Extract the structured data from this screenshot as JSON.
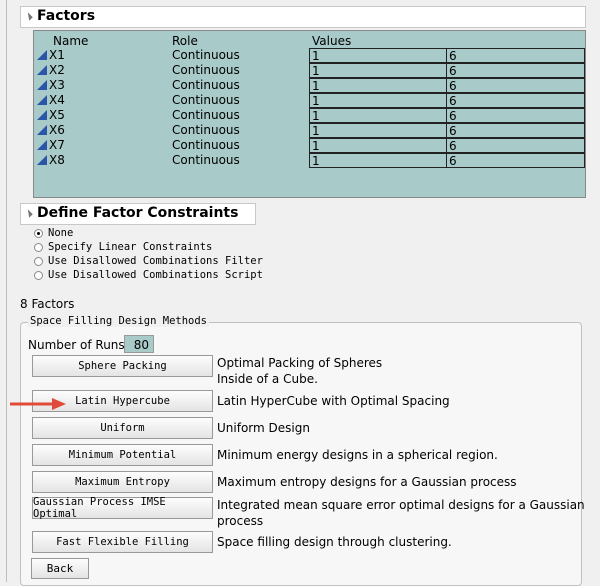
{
  "factors": {
    "title": "Factors",
    "columns": [
      "Name",
      "Role",
      "Values"
    ],
    "rows": [
      {
        "name": "X1",
        "role": "Continuous",
        "low": "1",
        "high": "6"
      },
      {
        "name": "X2",
        "role": "Continuous",
        "low": "1",
        "high": "6"
      },
      {
        "name": "X3",
        "role": "Continuous",
        "low": "1",
        "high": "6"
      },
      {
        "name": "X4",
        "role": "Continuous",
        "low": "1",
        "high": "6"
      },
      {
        "name": "X5",
        "role": "Continuous",
        "low": "1",
        "high": "6"
      },
      {
        "name": "X6",
        "role": "Continuous",
        "low": "1",
        "high": "6"
      },
      {
        "name": "X7",
        "role": "Continuous",
        "low": "1",
        "high": "6"
      },
      {
        "name": "X8",
        "role": "Continuous",
        "low": "1",
        "high": "6"
      }
    ]
  },
  "constraints": {
    "title": "Define Factor Constraints",
    "options": [
      "None",
      "Specify Linear Constraints",
      "Use Disallowed Combinations Filter",
      "Use Disallowed Combinations Script"
    ],
    "selected": "None"
  },
  "factor_count": "8 Factors",
  "methods": {
    "title": "Space Filling Design Methods",
    "runs_label": "Number of Runs:",
    "runs_value": "80",
    "buttons": [
      {
        "label": "Sphere Packing",
        "desc": "Optimal Packing of Spheres\nInside of a Cube."
      },
      {
        "label": "Latin Hypercube",
        "desc": "Latin HyperCube with Optimal Spacing"
      },
      {
        "label": "Uniform",
        "desc": "Uniform Design"
      },
      {
        "label": "Minimum Potential",
        "desc": "Minimum energy designs in a spherical region."
      },
      {
        "label": "Maximum Entropy",
        "desc": "Maximum entropy designs for a Gaussian process"
      },
      {
        "label": "Gaussian Process IMSE Optimal",
        "desc": "Integrated mean square error optimal designs for a Gaussian\nprocess"
      },
      {
        "label": "Fast Flexible Filling",
        "desc": "Space filling design through clustering."
      }
    ],
    "back_label": "Back"
  },
  "colors": {
    "table_bg": "#a8cac8",
    "arrow": "#e04a3a",
    "factor_icon": "#2a55a8"
  }
}
